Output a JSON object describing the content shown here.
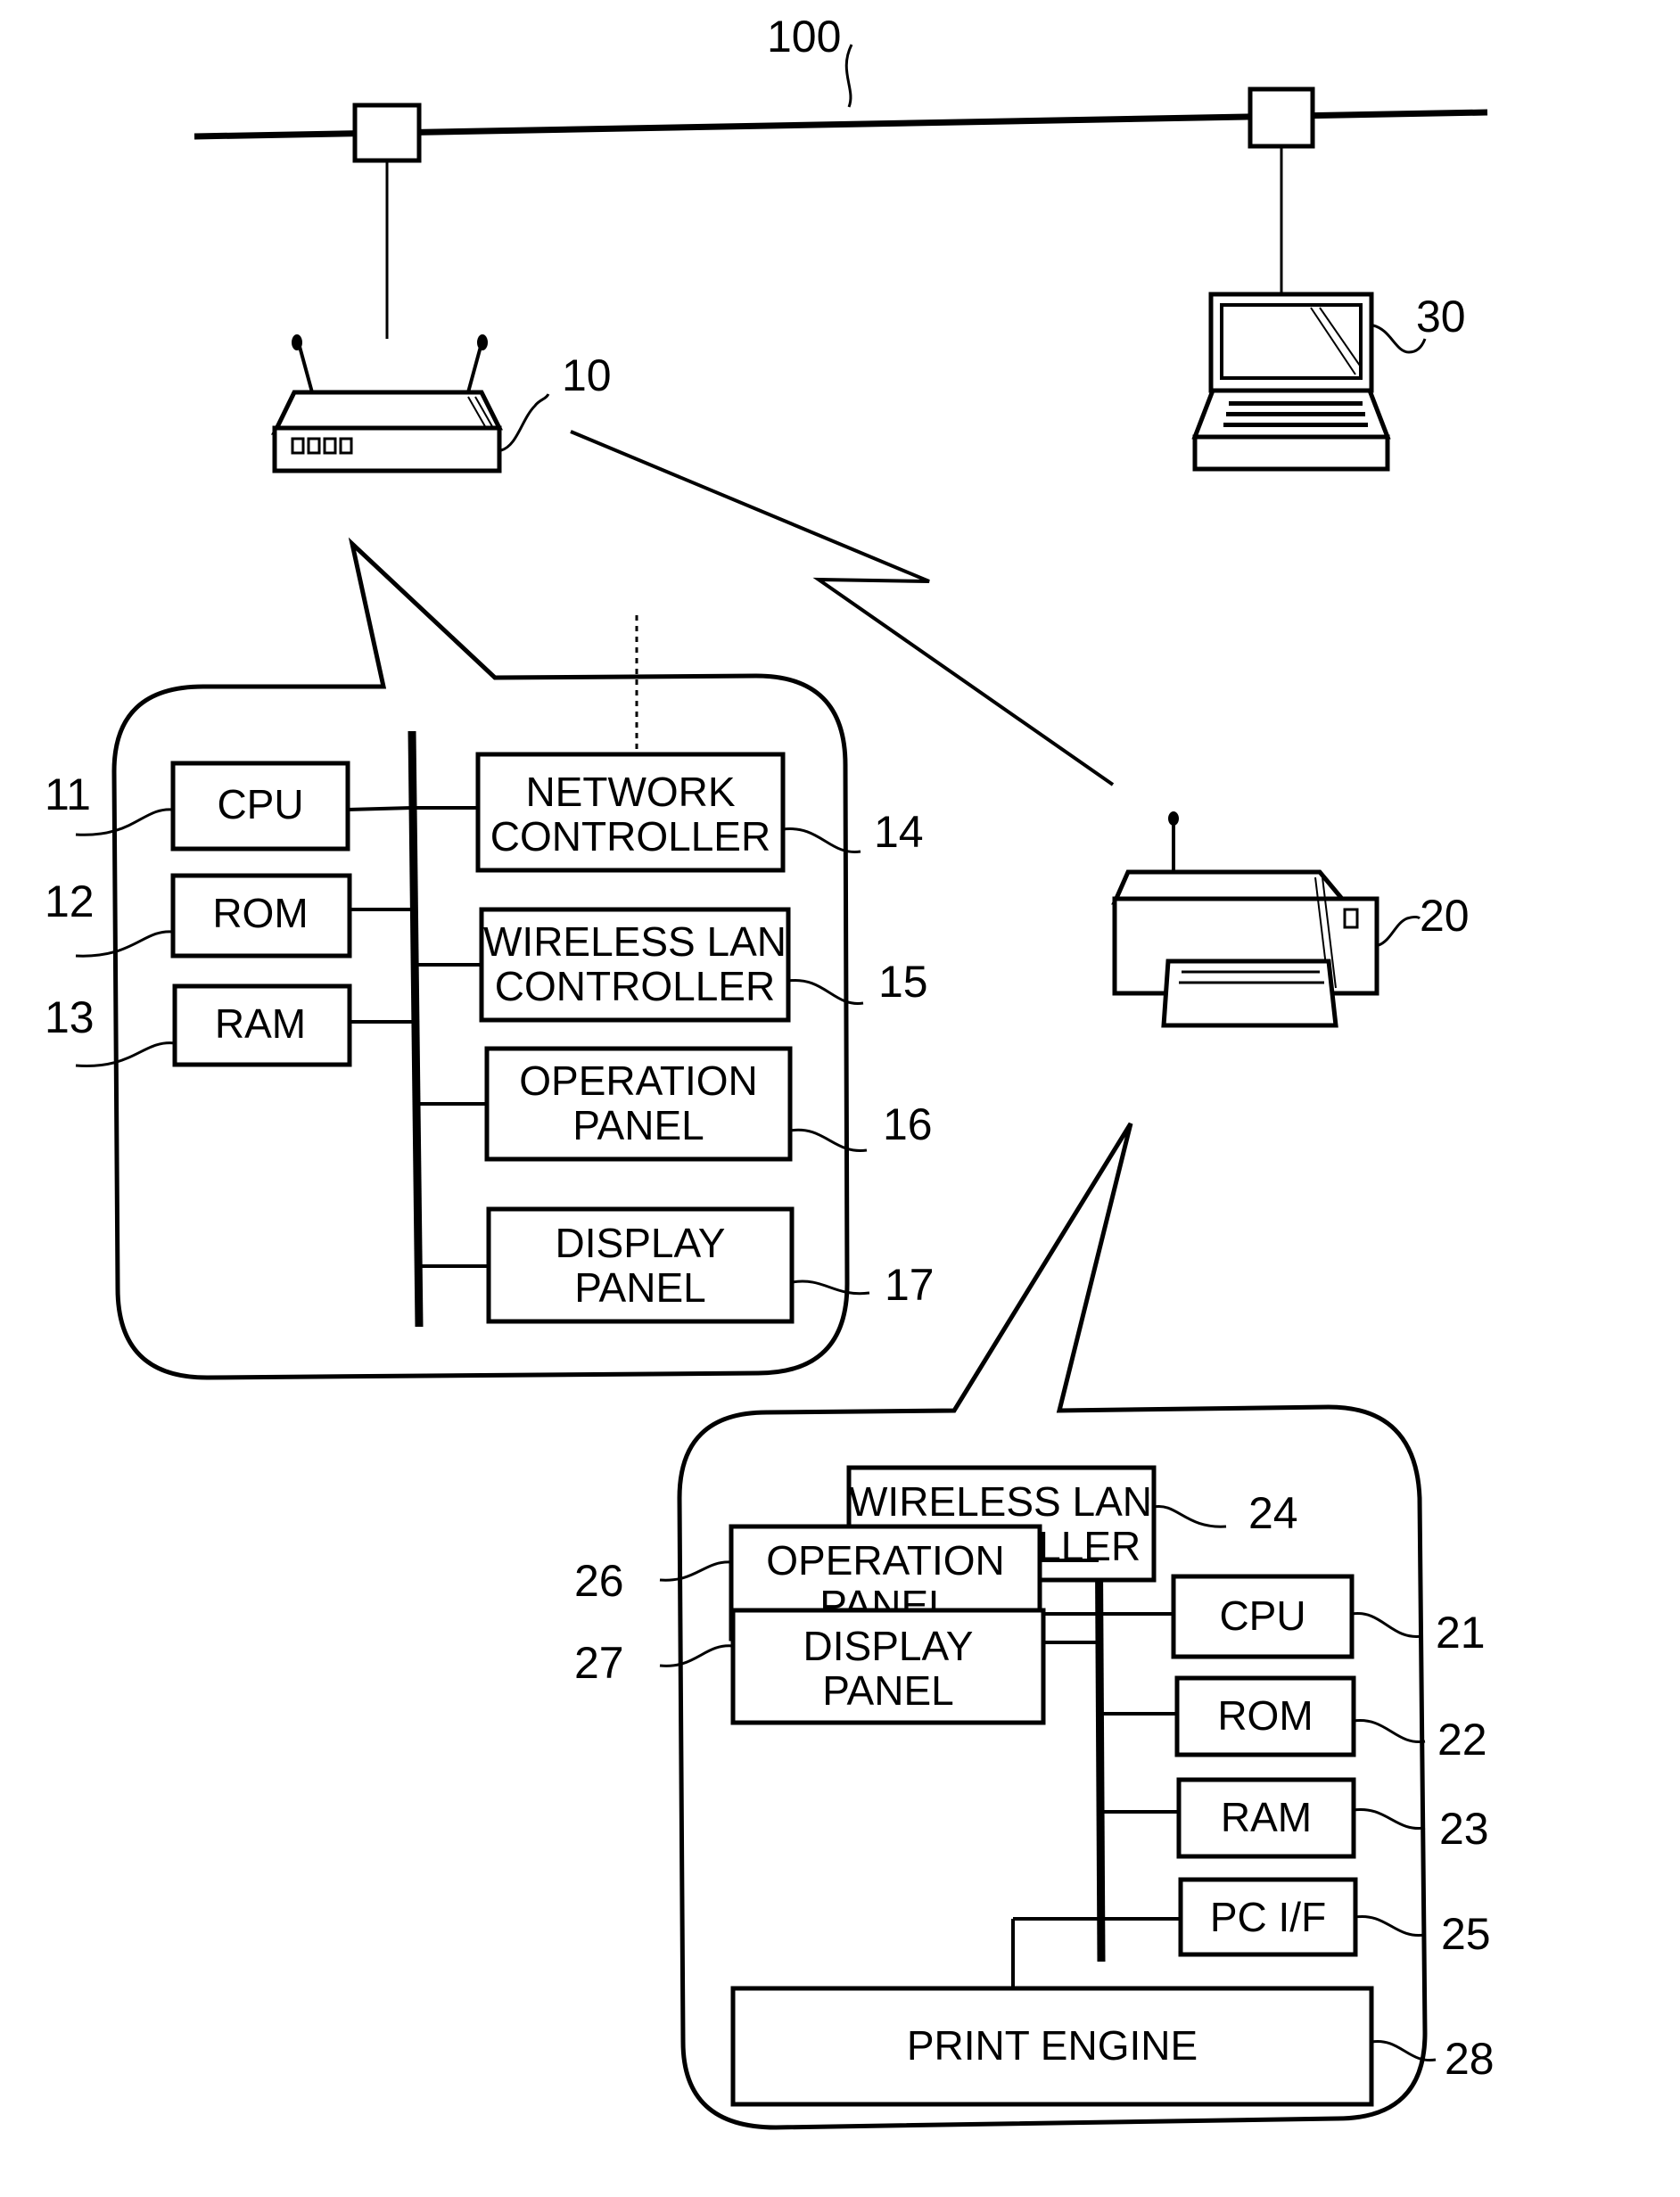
{
  "figure": {
    "network": {
      "ref": "100"
    },
    "devices": {
      "access_point": {
        "ref": "10"
      },
      "printer": {
        "ref": "20"
      },
      "computer": {
        "ref": "30"
      }
    },
    "access_point_block": {
      "blocks": [
        {
          "ref": "11",
          "line1": "CPU",
          "line2": ""
        },
        {
          "ref": "12",
          "line1": "ROM",
          "line2": ""
        },
        {
          "ref": "13",
          "line1": "RAM",
          "line2": ""
        },
        {
          "ref": "14",
          "line1": "NETWORK",
          "line2": "CONTROLLER"
        },
        {
          "ref": "15",
          "line1": "WIRELESS LAN",
          "line2": "CONTROLLER"
        },
        {
          "ref": "16",
          "line1": "OPERATION",
          "line2": "PANEL"
        },
        {
          "ref": "17",
          "line1": "DISPLAY",
          "line2": "PANEL"
        }
      ]
    },
    "printer_block": {
      "blocks": [
        {
          "ref": "24",
          "line1": "WIRELESS LAN",
          "line2": "CONTROLLER"
        },
        {
          "ref": "21",
          "line1": "CPU",
          "line2": ""
        },
        {
          "ref": "22",
          "line1": "ROM",
          "line2": ""
        },
        {
          "ref": "23",
          "line1": "RAM",
          "line2": ""
        },
        {
          "ref": "25",
          "line1": "PC I/F",
          "line2": ""
        },
        {
          "ref": "26",
          "line1": "OPERATION",
          "line2": "PANEL"
        },
        {
          "ref": "27",
          "line1": "DISPLAY",
          "line2": "PANEL"
        },
        {
          "ref": "28",
          "line1": "PRINT ENGINE",
          "line2": ""
        }
      ]
    }
  }
}
